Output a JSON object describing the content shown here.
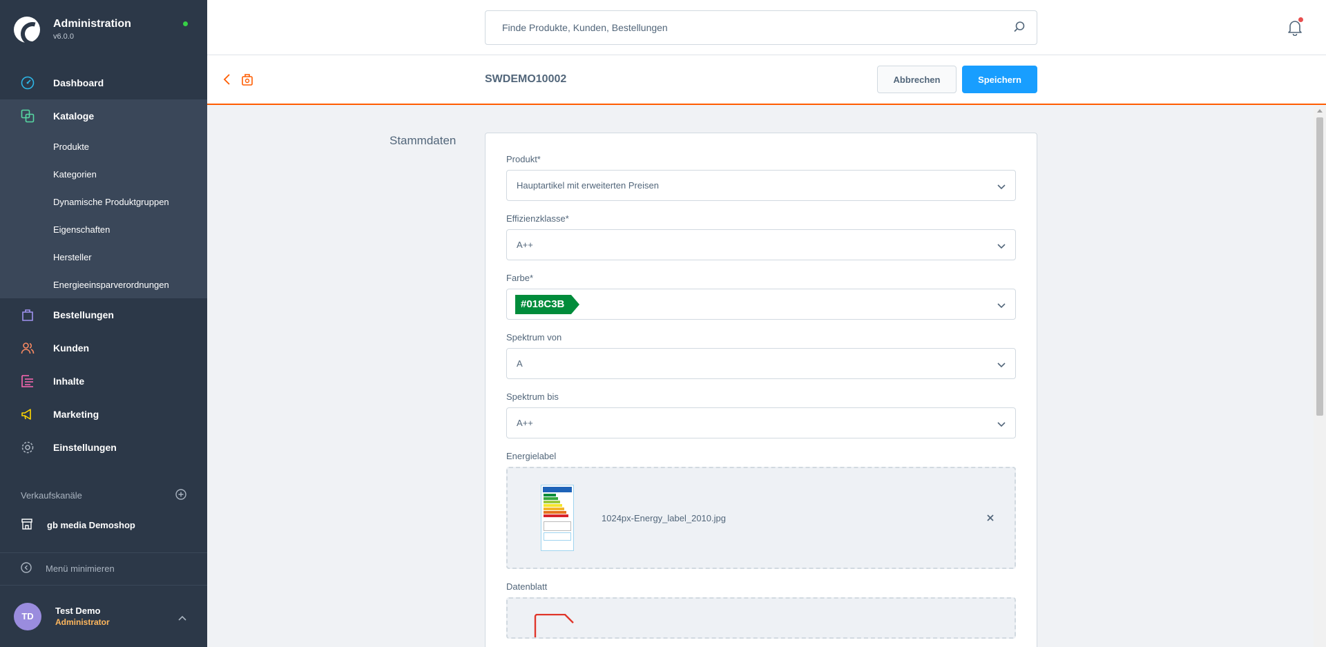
{
  "app": {
    "title": "Administration",
    "version": "v6.0.0"
  },
  "nav": {
    "dashboard": "Dashboard",
    "catalogs": "Kataloge",
    "catalog_items": [
      "Produkte",
      "Kategorien",
      "Dynamische Produktgruppen",
      "Eigenschaften",
      "Hersteller",
      "Energieeinsparverordnungen"
    ],
    "orders": "Bestellungen",
    "customers": "Kunden",
    "content": "Inhalte",
    "marketing": "Marketing",
    "settings": "Einstellungen"
  },
  "sales_channels": {
    "heading": "Verkaufskanäle",
    "items": [
      "gb media Demoshop"
    ]
  },
  "minimize_label": "Menü minimieren",
  "user": {
    "initials": "TD",
    "name": "Test Demo",
    "role": "Administrator"
  },
  "search": {
    "placeholder": "Finde Produkte, Kunden, Bestellungen"
  },
  "smartbar": {
    "title": "SWDEMO10002",
    "cancel_label": "Abbrechen",
    "save_label": "Speichern"
  },
  "section": {
    "title": "Stammdaten"
  },
  "form": {
    "product": {
      "label": "Produkt*",
      "value": "Hauptartikel mit erweiterten Preisen"
    },
    "efficiency_class": {
      "label": "Effizienzklasse*",
      "value": "A++"
    },
    "color": {
      "label": "Farbe*",
      "value": "#018C3B"
    },
    "spectrum_from": {
      "label": "Spektrum von",
      "value": "A"
    },
    "spectrum_to": {
      "label": "Spektrum bis",
      "value": "A++"
    },
    "energy_label": {
      "label": "Energielabel",
      "file_name": "1024px-Energy_label_2010.jpg"
    },
    "datasheet": {
      "label": "Datenblatt"
    }
  },
  "colors": {
    "accent": "#189eff",
    "smartbar_border": "#ff5c00",
    "sidebar_bg": "#2c3848",
    "color_tag": "#018c3b"
  },
  "icons": [
    "dashboard-icon",
    "catalog-icon",
    "orders-icon",
    "customers-icon",
    "content-icon",
    "marketing-icon",
    "settings-icon",
    "plus-circle-icon",
    "storefront-icon",
    "minimize-icon",
    "chevron-up-icon",
    "search-icon",
    "bell-icon",
    "back-arrow-icon",
    "language-icon",
    "chevron-down-icon",
    "close-icon",
    "pdf-icon"
  ]
}
